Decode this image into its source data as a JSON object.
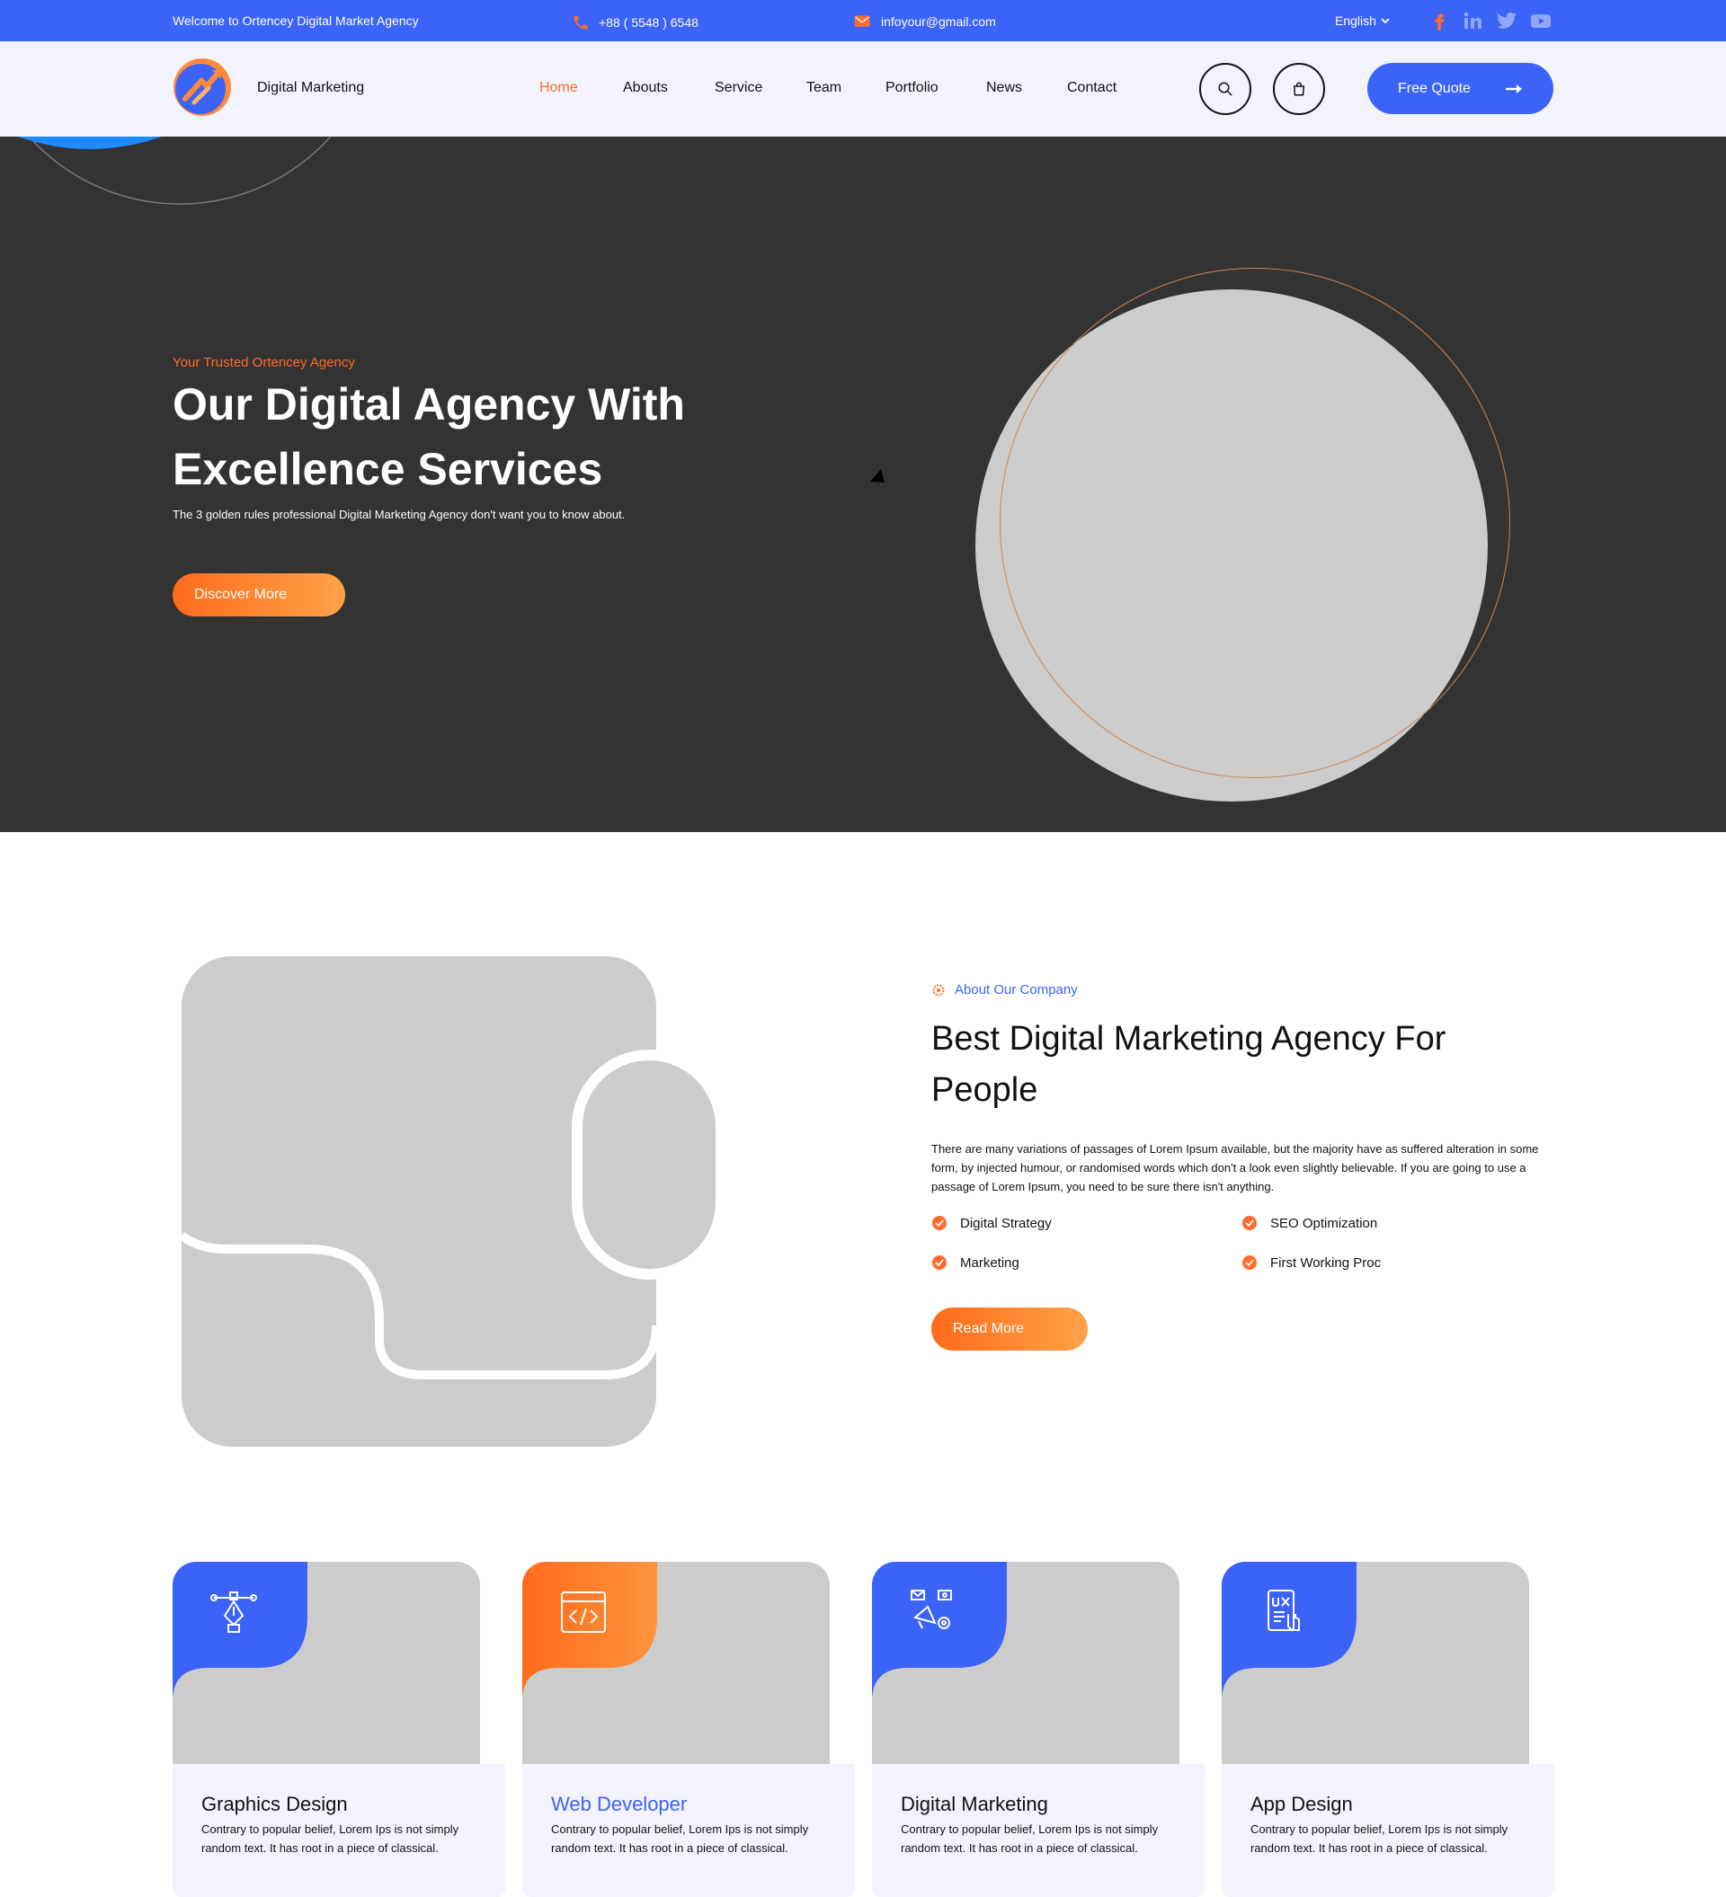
{
  "topbar": {
    "welcome": "Welcome to Ortencey Digital Market Agency",
    "phone": "+88 ( 5548 ) 6548",
    "email": "infoyour@gmail.com",
    "language": "English",
    "socials": [
      "facebook-icon",
      "linkedin-icon",
      "twitter-icon",
      "youtube-icon"
    ]
  },
  "header": {
    "brand": "Digital Marketing",
    "nav": [
      {
        "label": "Home",
        "active": true
      },
      {
        "label": "Abouts"
      },
      {
        "label": "Service"
      },
      {
        "label": "Team"
      },
      {
        "label": "Portfolio"
      },
      {
        "label": "News"
      },
      {
        "label": "Contact"
      }
    ],
    "quote_label": "Free Quote"
  },
  "hero": {
    "tagline": "Your Trusted Ortencey Agency",
    "title_line1": "Our Digital Agency With",
    "title_line2": "Excellence Services",
    "description": "The 3 golden rules professional Digital Marketing Agency don't want you to know about.",
    "cta": "Discover More"
  },
  "about": {
    "subtitle": "About Our Company",
    "title": "Best Digital Marketing Agency For People",
    "text": "There are many variations of passages of Lorem Ipsum available, but the majority have as suffered alteration in some form, by injected humour, or randomised words which don't a look even slightly believable. If you are going to use a passage of Lorem Ipsum, you need to be sure there isn't anything.",
    "features": [
      "Digital Strategy",
      "SEO Optimization",
      "Marketing",
      "First Working Proc"
    ],
    "cta": "Read More"
  },
  "services": [
    {
      "title": "Graphics Design",
      "text": "Contrary to popular belief, Lorem Ips is not simply random text. It has root in a piece of classical.",
      "icon": "pen-tool-icon"
    },
    {
      "title": "Web Developer",
      "text": "Contrary to popular belief, Lorem Ips is not simply random text. It has root in a piece of classical.",
      "icon": "code-window-icon"
    },
    {
      "title": "Digital Marketing",
      "text": "Contrary to popular belief, Lorem Ips is not simply random text. It has root in a piece of classical.",
      "icon": "megaphone-icon"
    },
    {
      "title": "App Design",
      "text": "Contrary to popular belief, Lorem Ips is not simply random text. It has root in a piece of classical.",
      "icon": "ux-phone-icon"
    }
  ],
  "colors": {
    "primary_blue": "#3b63f7",
    "accent_orange": "#ff6b2c",
    "hero_bg": "#333333",
    "placeholder_gray": "#cccccc",
    "light_bg": "#f2f3fc"
  }
}
